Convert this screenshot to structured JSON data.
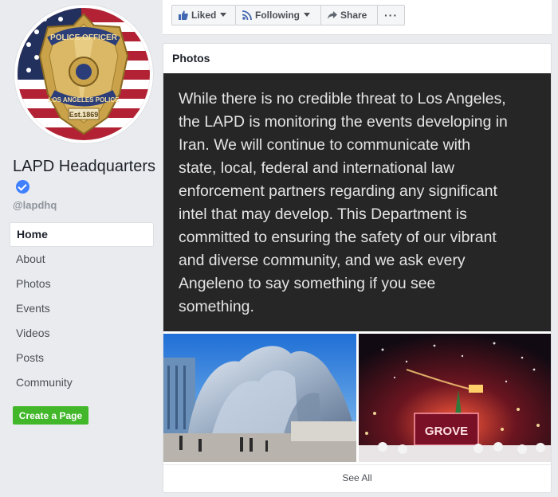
{
  "page": {
    "name": "LAPD Headquarters",
    "handle": "@lapdhq",
    "badge_lines": [
      "POLICE OFFICER",
      "LOS ANGELES POLICE",
      "Est.1869"
    ]
  },
  "nav": {
    "items": [
      {
        "label": "Home",
        "active": true
      },
      {
        "label": "About"
      },
      {
        "label": "Photos"
      },
      {
        "label": "Events"
      },
      {
        "label": "Videos"
      },
      {
        "label": "Posts"
      },
      {
        "label": "Community"
      }
    ]
  },
  "create_page_label": "Create a Page",
  "actions": {
    "liked": "Liked",
    "following": "Following",
    "share": "Share",
    "more": "···"
  },
  "photos": {
    "title": "Photos",
    "statement": "While there is no credible threat to Los Angeles,\nthe LAPD is monitoring the events developing in\nIran.  We will continue to communicate with\nstate, local, federal and international law\nenforcement partners regarding any significant\nintel that may develop.  This Department is\ncommitted to ensuring the safety of our vibrant\nand diverse community, and we ask every\nAngeleno to say something if you see\nsomething.",
    "grove_sign": "GROVE",
    "see_all": "See All"
  },
  "colors": {
    "accent": "#4080ff",
    "create_button": "#42b72a",
    "statement_bg": "#262626"
  }
}
